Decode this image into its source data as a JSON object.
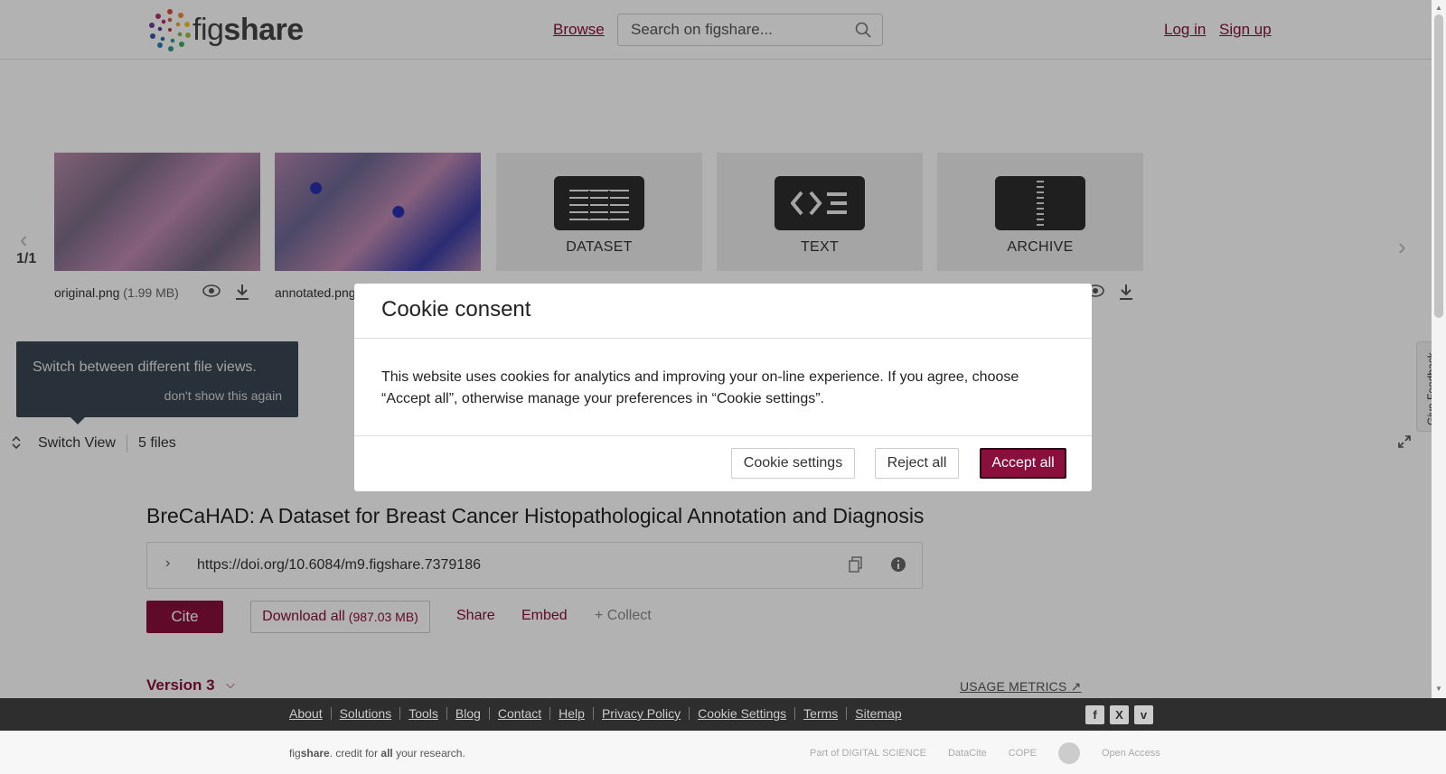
{
  "header": {
    "logo_text": "fig",
    "logo_text_bold": "share",
    "browse": "Browse",
    "search_placeholder": "Search on figshare...",
    "login": "Log in",
    "signup": "Sign up"
  },
  "viewer": {
    "page_count": "1/1",
    "thumbnails": [
      {
        "label": "",
        "file": "original.png",
        "size": "(1.99 MB)"
      },
      {
        "label": "",
        "file": "annotated.png",
        "size": ""
      },
      {
        "label": "DATASET"
      },
      {
        "label": "TEXT"
      },
      {
        "label": "ARCHIVE"
      }
    ],
    "tip_text": "Switch between different file views.",
    "tip_dismiss": "don't show this again",
    "switch_view": "Switch View",
    "files_count": "5 files",
    "feedback": "Give Feedback"
  },
  "article": {
    "title": "BreCaHAD: A Dataset for Breast Cancer Histopathological Annotation and Diagnosis",
    "doi": "https://doi.org/10.6084/m9.figshare.7379186",
    "cite": "Cite",
    "download_all": "Download all",
    "download_size": "(987.03 MB)",
    "share": "Share",
    "embed": "Embed",
    "collect": "+ Collect",
    "version": "Version 3",
    "usage_metrics": "USAGE METRICS"
  },
  "footer": {
    "links": [
      "About",
      "Solutions",
      "Tools",
      "Blog",
      "Contact",
      "Help",
      "Privacy Policy",
      "Cookie Settings",
      "Terms",
      "Sitemap"
    ],
    "tagline_pre": "fig",
    "tagline_bold": "share",
    "tagline_mid": ". credit for ",
    "tagline_all": "all",
    "tagline_post": " your research.",
    "partners": [
      "Part of DIGITAL SCIENCE",
      "DataCite",
      "COPE",
      "",
      "Open Access"
    ]
  },
  "cookie": {
    "title": "Cookie consent",
    "body": "This website uses cookies for analytics and improving your on-line experience. If you agree, choose “Accept all”, otherwise manage your preferences in “Cookie settings”.",
    "settings": "Cookie settings",
    "reject": "Reject all",
    "accept": "Accept all"
  },
  "colors": {
    "brand": "#8a0f3c",
    "footer_dark": "#2e2e2e",
    "tip_bg": "#3a4654"
  },
  "icons": [
    "search-icon",
    "eye-icon",
    "download-icon",
    "chevron-left-icon",
    "chevron-right-icon",
    "switch-icon",
    "expand-icon",
    "chevron-right-icon",
    "copy-icon",
    "info-icon",
    "chevron-down-icon",
    "external-link-icon",
    "facebook-icon",
    "x-icon",
    "vimeo-icon"
  ]
}
